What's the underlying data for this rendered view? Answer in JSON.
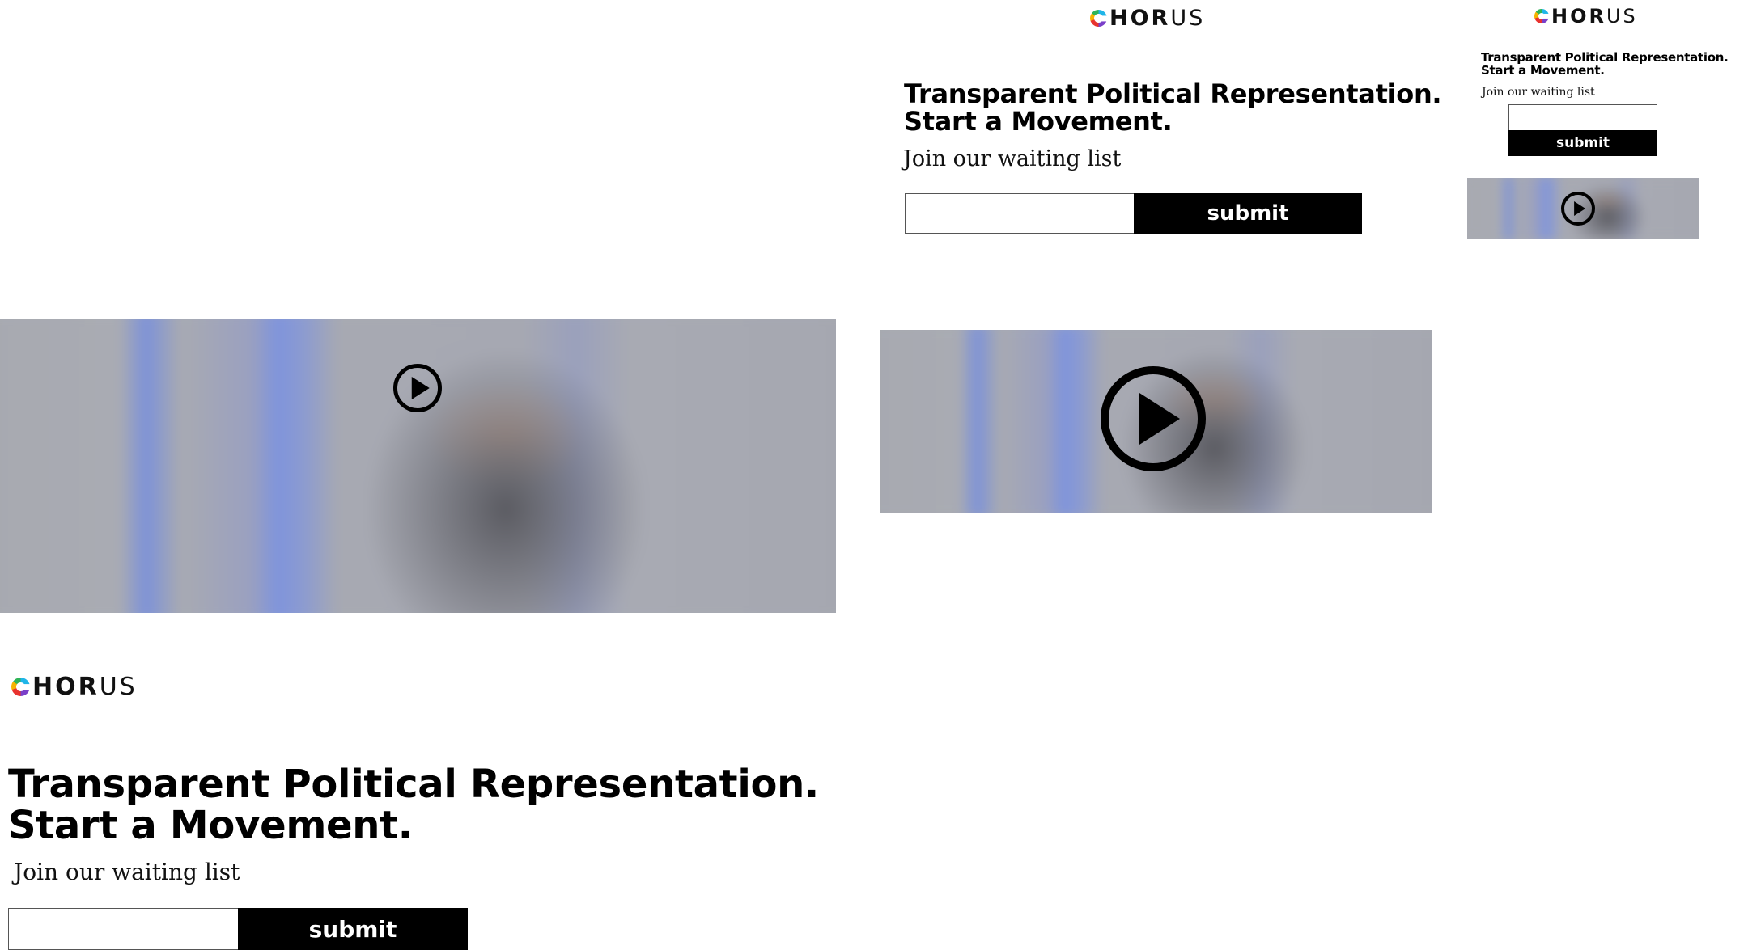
{
  "brand": {
    "logo_bold": "HOR",
    "logo_light": "US"
  },
  "hero": {
    "headline_line1": "Transparent Political Representation.",
    "headline_line2": "Start a Movement.",
    "subheading": "Join our waiting list"
  },
  "form": {
    "email_value": "",
    "submit_label": "submit"
  },
  "video": {
    "play_icon": "play-circle-icon"
  }
}
